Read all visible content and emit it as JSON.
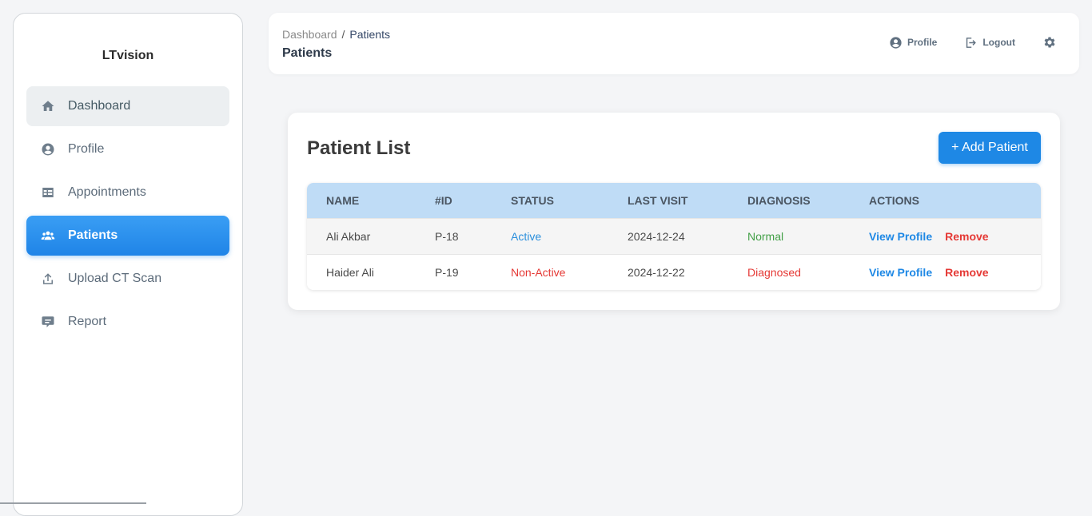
{
  "brand": "LTvision",
  "sidebar": {
    "items": [
      {
        "label": "Dashboard",
        "icon": "home-icon"
      },
      {
        "label": "Profile",
        "icon": "user-circle-icon"
      },
      {
        "label": "Appointments",
        "icon": "table-icon"
      },
      {
        "label": "Patients",
        "icon": "users-icon"
      },
      {
        "label": "Upload CT Scan",
        "icon": "upload-icon"
      },
      {
        "label": "Report",
        "icon": "comment-icon"
      }
    ]
  },
  "topbar": {
    "breadcrumb_root": "Dashboard",
    "breadcrumb_sep": "/",
    "breadcrumb_current": "Patients",
    "page_title": "Patients",
    "profile_label": "Profile",
    "logout_label": "Logout"
  },
  "patients_card": {
    "title": "Patient List",
    "add_button": "+ Add Patient",
    "columns": [
      "NAME",
      "#ID",
      "STATUS",
      "LAST VISIT",
      "DIAGNOSIS",
      "ACTIONS"
    ],
    "rows": [
      {
        "name": "Ali Akbar",
        "id": "P-18",
        "status": "Active",
        "last_visit": "2024-12-24",
        "diagnosis": "Normal",
        "view": "View Profile",
        "remove": "Remove"
      },
      {
        "name": "Haider Ali",
        "id": "P-19",
        "status": "Non-Active",
        "last_visit": "2024-12-22",
        "diagnosis": "Diagnosed",
        "view": "View Profile",
        "remove": "Remove"
      }
    ]
  },
  "colors": {
    "accent": "#1e88e5",
    "header_row": "#bfdcf6",
    "active_status": "#2a8fdc",
    "danger": "#e53935",
    "success": "#43a047"
  }
}
